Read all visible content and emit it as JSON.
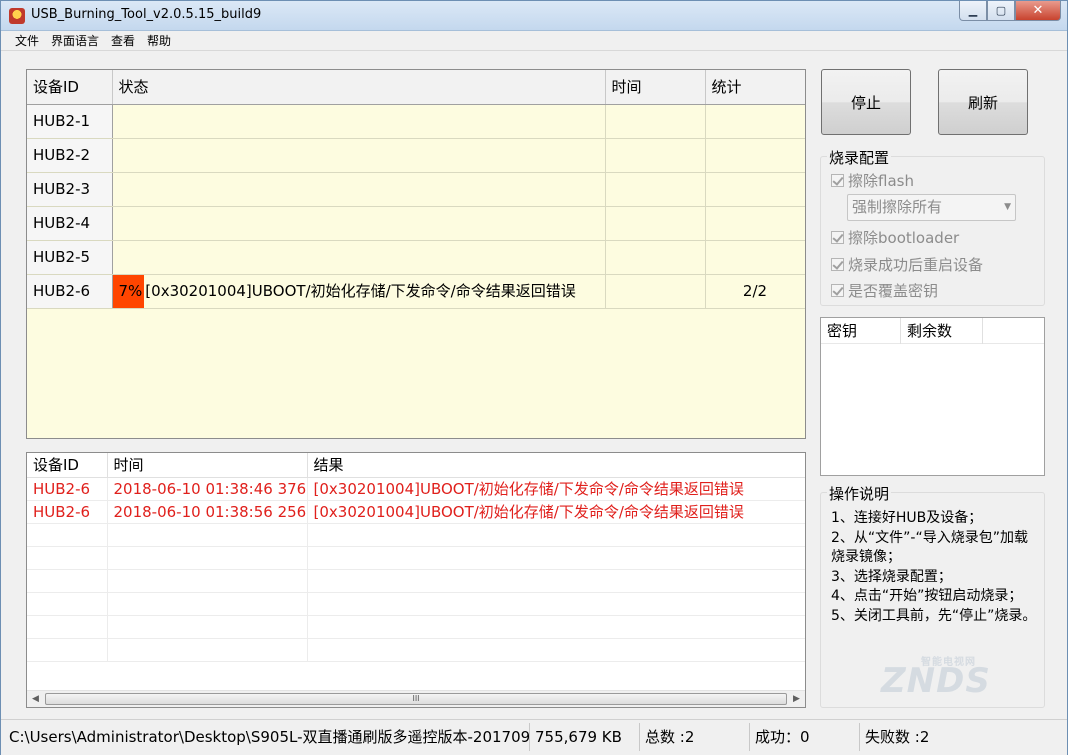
{
  "window": {
    "title": "USB_Burning_Tool_v2.0.5.15_build9"
  },
  "menu": [
    {
      "label": "文件"
    },
    {
      "label": "界面语言"
    },
    {
      "label": "查看"
    },
    {
      "label": "帮助"
    }
  ],
  "grid": {
    "columns": [
      "设备ID",
      "状态",
      "时间",
      "统计"
    ],
    "rows": [
      {
        "id": "HUB2-1",
        "progress": "",
        "status": "",
        "time": "",
        "stat": ""
      },
      {
        "id": "HUB2-2",
        "progress": "",
        "status": "",
        "time": "",
        "stat": ""
      },
      {
        "id": "HUB2-3",
        "progress": "",
        "status": "",
        "time": "",
        "stat": ""
      },
      {
        "id": "HUB2-4",
        "progress": "",
        "status": "",
        "time": "",
        "stat": ""
      },
      {
        "id": "HUB2-5",
        "progress": "",
        "status": "",
        "time": "",
        "stat": ""
      },
      {
        "id": "HUB2-6",
        "progress": "7%",
        "status": "[0x30201004]UBOOT/初始化存储/下发命令/命令结果返回错误",
        "time": "",
        "stat": "2/2"
      }
    ]
  },
  "log": {
    "columns": [
      "设备ID",
      "时间",
      "结果"
    ],
    "rows": [
      {
        "id": "HUB2-6",
        "time": "2018-06-10 01:38:46 376",
        "result": "[0x30201004]UBOOT/初始化存储/下发命令/命令结果返回错误"
      },
      {
        "id": "HUB2-6",
        "time": "2018-06-10 01:38:56 256",
        "result": "[0x30201004]UBOOT/初始化存储/下发命令/命令结果返回错误"
      }
    ],
    "scroll_thumb": "III"
  },
  "buttons": {
    "stop": "停止",
    "refresh": "刷新"
  },
  "burn_config": {
    "legend": "烧录配置",
    "erase_flash": "擦除flash",
    "erase_mode": "强制擦除所有",
    "erase_bootloader": "擦除bootloader",
    "reboot_after": "烧录成功后重启设备",
    "overwrite_key": "是否覆盖密钥"
  },
  "keys": {
    "columns": [
      "密钥",
      "剩余数"
    ]
  },
  "help": {
    "legend": "操作说明",
    "text": "1、连接好HUB及设备；\n2、从“文件”-“导入烧录包”加载烧录镜像；\n3、选择烧录配置；\n4、点击“开始”按钮启动烧录；\n5、关闭工具前，先“停止”烧录。"
  },
  "statusbar": {
    "path": "C:\\Users\\Administrator\\Desktop\\S905L-双直播通刷版多遥控版本-201709",
    "size": "755,679 KB",
    "total": "总数 :2",
    "success": "成功：0",
    "failed": "失败数 :2"
  },
  "watermark": {
    "text": "ZNDS",
    "sub": "智能电视网"
  },
  "colors": {
    "progress_fill": "#ff4500",
    "error_text": "#e0201c",
    "grid_bg": "#fdfce0"
  }
}
